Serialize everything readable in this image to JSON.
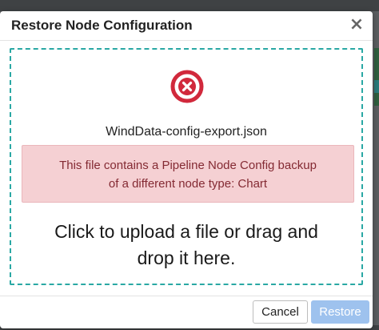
{
  "dialog": {
    "title": "Restore Node Configuration",
    "close_label": "×",
    "close_icon": "close-icon"
  },
  "dropzone": {
    "status_icon": "error-circle-x-icon",
    "file_name": "WindData-config-export.json",
    "error": {
      "line1": "This file contains a Pipeline Node Config backup",
      "line2": "of a different node type: Chart"
    },
    "prompt": {
      "line1": "Click to upload a file or drag and",
      "line2": "drop it here."
    }
  },
  "footer": {
    "cancel_label": "Cancel",
    "restore_label": "Restore",
    "restore_disabled": true
  },
  "colors": {
    "error_icon": "#d1293c",
    "dropzone_border": "#2aa8a4",
    "error_bg": "#f5d0d3",
    "error_text": "#842a33",
    "restore_button_disabled": "#9ec2ee"
  }
}
